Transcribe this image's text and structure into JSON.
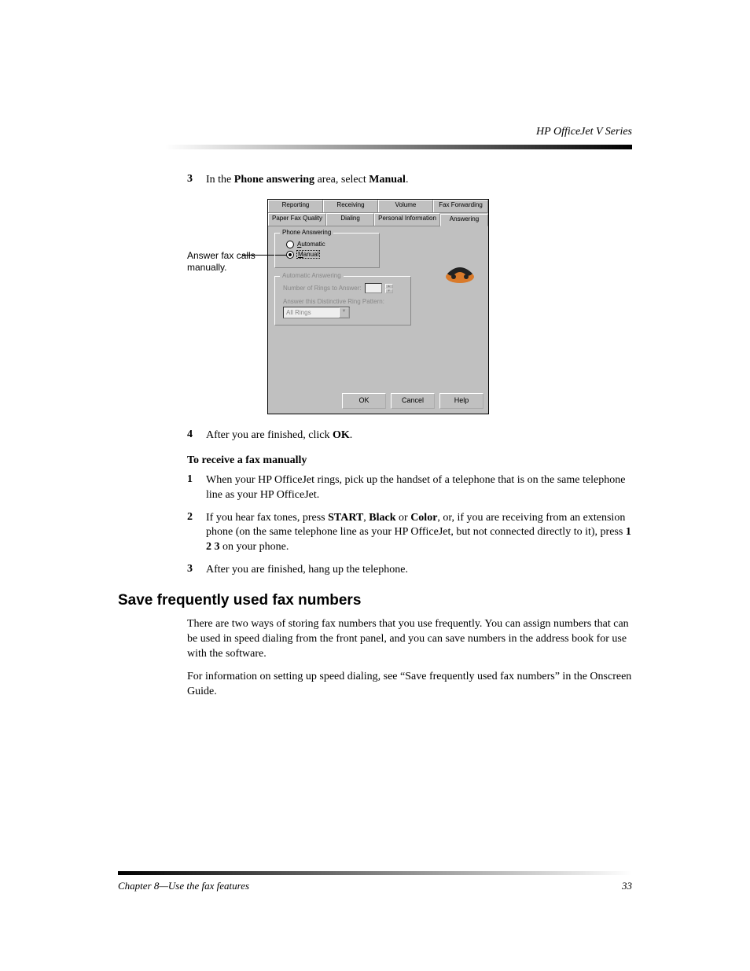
{
  "header": {
    "title": "HP OfficeJet V Series"
  },
  "steps_a": [
    {
      "num": "3",
      "html": "In the <b>Phone answering</b> area, select <b>Manual</b>."
    }
  ],
  "callout": "Answer fax calls manually.",
  "dialog": {
    "tabs_row1": [
      "Reporting",
      "Receiving",
      "Volume",
      "Fax Forwarding"
    ],
    "tabs_row2": [
      "Paper Fax Quality",
      "Dialing",
      "Personal Information",
      "Answering"
    ],
    "group1": {
      "title": "Phone Answering",
      "radio_auto": "Automatic",
      "radio_auto_u": "A",
      "radio_manual": "Manual",
      "radio_manual_u": "M"
    },
    "group2": {
      "title": "Automatic Answering",
      "rings_label": "Number of Rings to Answer:",
      "pattern_label": "Answer this Distinctive Ring Pattern:",
      "combo_value": "All Rings"
    },
    "buttons": {
      "ok": "OK",
      "cancel": "Cancel",
      "help": "Help"
    }
  },
  "steps_b": [
    {
      "num": "4",
      "html": "After you are finished, click <b>OK</b>."
    }
  ],
  "subhead": "To receive a fax manually",
  "steps_c": [
    {
      "num": "1",
      "html": "When your HP OfficeJet rings, pick up the handset of a telephone that is on the same telephone line as your HP OfficeJet."
    },
    {
      "num": "2",
      "html": "If you hear fax tones, press <b>START</b>, <b>Black</b> or <b>Color</b>, or, if you are receiving from an extension phone (on the same telephone line as your HP OfficeJet, but not connected directly to it), press <b>1 2 3</b> on your phone."
    },
    {
      "num": "3",
      "html": "After you are finished, hang up the telephone."
    }
  ],
  "h2": "Save frequently used fax numbers",
  "para1": "There are two ways of storing fax numbers that you use frequently. You can assign numbers that can be used in speed dialing from the front panel, and you can save numbers in the address book for use with the software.",
  "para2": "For information on setting up speed dialing, see “Save frequently used fax numbers” in the Onscreen Guide.",
  "footer": {
    "left": "Chapter 8—Use the fax features",
    "page": "33"
  }
}
